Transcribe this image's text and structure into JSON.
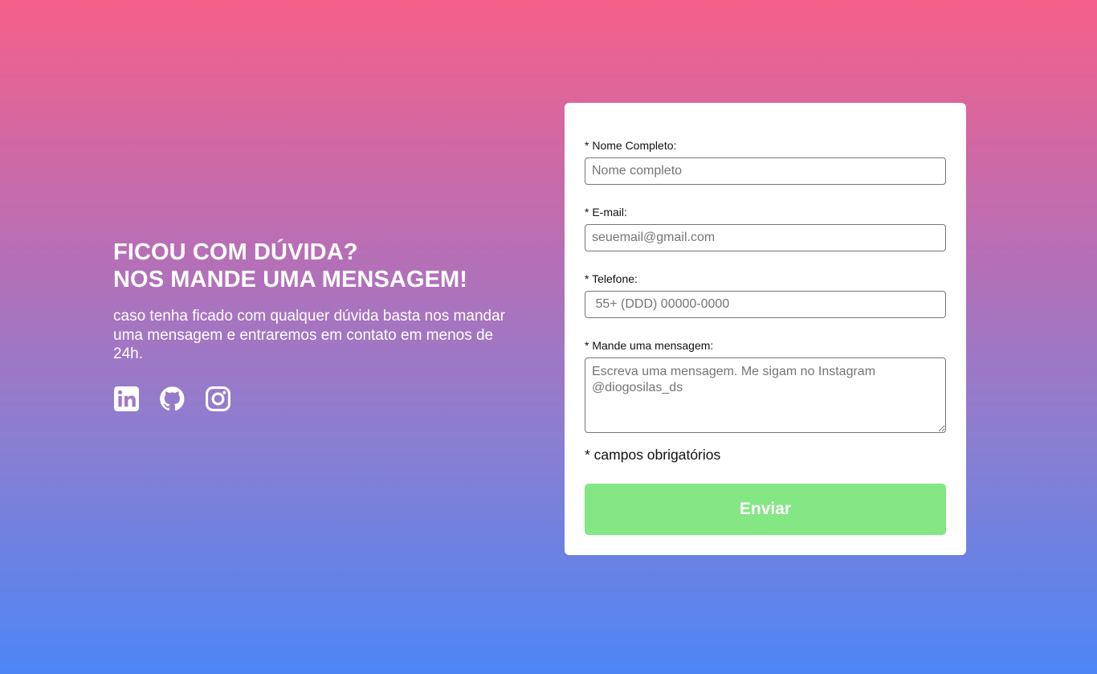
{
  "intro": {
    "heading_line1": "FICOU COM DÚVIDA?",
    "heading_line2": "NOS MANDE UMA MENSAGEM!",
    "description": "caso tenha ficado com qualquer dúvida basta nos mandar uma mensagem e entraremos em contato em menos de 24h."
  },
  "social_links": [
    {
      "icon": "linkedin-icon"
    },
    {
      "icon": "github-icon"
    },
    {
      "icon": "instagram-icon"
    }
  ],
  "form": {
    "name": {
      "label": "* Nome Completo:",
      "placeholder": "Nome completo",
      "value": ""
    },
    "email": {
      "label": "* E-mail:",
      "placeholder": "seuemail@gmail.com",
      "value": ""
    },
    "phone": {
      "label": "* Telefone:",
      "placeholder": " 55+ (DDD) 00000-0000",
      "value": ""
    },
    "message": {
      "label": "* Mande uma mensagem:",
      "placeholder": "Escreva uma mensagem. Me sigam no Instagram @diogosilas_ds",
      "value": ""
    },
    "required_note": "* campos obrigatórios",
    "submit_label": "Enviar"
  },
  "colors": {
    "gradient_top": "#f5608a",
    "gradient_bottom": "#4d85f5",
    "submit_button": "#85e684",
    "card": "#ffffff"
  }
}
